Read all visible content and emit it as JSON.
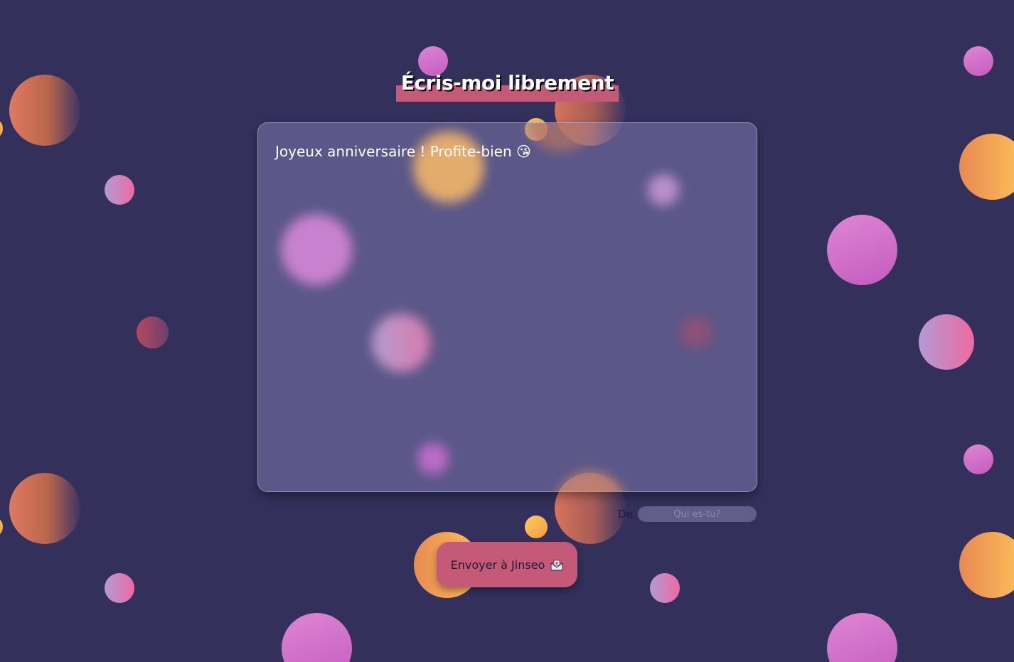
{
  "page": {
    "title": "Écris-moi librement"
  },
  "letter": {
    "message": "Joyeux anniversaire ! Profite-bien 😘",
    "emoji_icon": "kissing-face-icon"
  },
  "sender": {
    "label": "De",
    "placeholder": "Qui es-tu?",
    "value": ""
  },
  "send_button": {
    "label": "Envoyer à Jinseo",
    "icon": "envelope-with-heart-icon"
  },
  "colors": {
    "background": "#33305c",
    "accent": "#c45a78",
    "glass": "#8c87be",
    "text": "#ffffff"
  }
}
